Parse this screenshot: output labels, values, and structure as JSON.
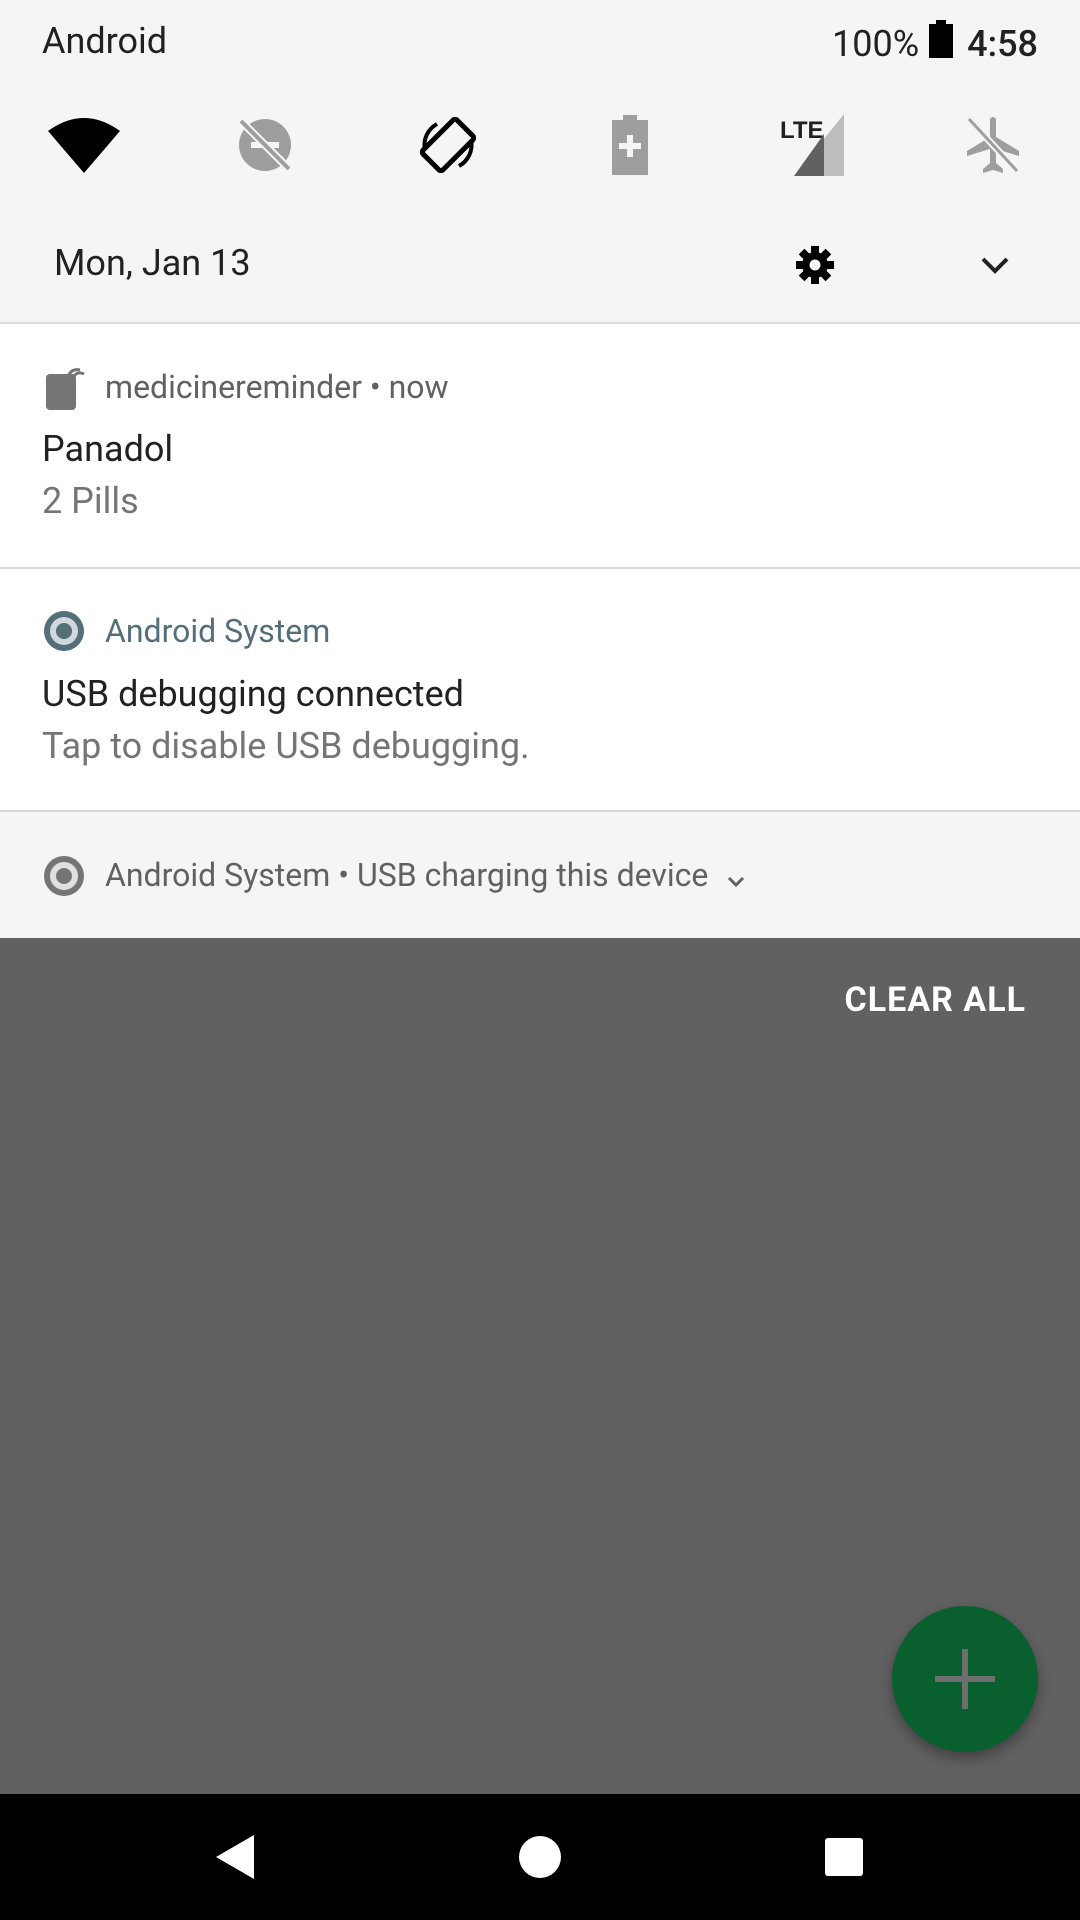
{
  "status_bar": {
    "carrier": "Android",
    "battery_percent": "100%",
    "time": "4:58"
  },
  "quick_settings": {
    "tiles": [
      {
        "name": "wifi",
        "icon": "wifi-icon"
      },
      {
        "name": "do-not-disturb",
        "icon": "dnd-off-icon"
      },
      {
        "name": "auto-rotate",
        "icon": "rotate-icon"
      },
      {
        "name": "battery-saver",
        "icon": "battery-saver-icon"
      },
      {
        "name": "mobile-data",
        "icon": "lte-signal-icon",
        "label": "LTE"
      },
      {
        "name": "airplane-mode",
        "icon": "airplane-icon"
      }
    ],
    "date": "Mon, Jan 13"
  },
  "notifications": [
    {
      "app": "medicinereminder",
      "separator": "•",
      "time": "now",
      "title": "Panadol",
      "text": "2 Pills"
    },
    {
      "app": "Android System",
      "title": "USB debugging connected",
      "text": "Tap to disable USB debugging."
    },
    {
      "app": "Android System",
      "separator": "•",
      "summary": "USB charging this device"
    }
  ],
  "clear_all_label": "CLEAR ALL",
  "colors": {
    "shade_bg": "#f5f5f5",
    "scrim": "#616161",
    "fab": "#0a5f2f",
    "android_system_accent": "#546e7a"
  }
}
